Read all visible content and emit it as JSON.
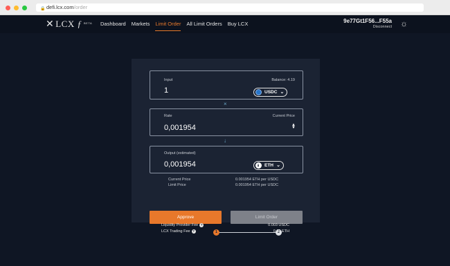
{
  "browser": {
    "url_host": "defi.lcx.com",
    "url_path": "/order"
  },
  "nav": {
    "logo_text": "LCX",
    "beta_label": "BETA",
    "links": [
      "Dashboard",
      "Markets",
      "Limit Order",
      "All Limit Orders",
      "Buy LCX"
    ],
    "active_link": "Limit Order",
    "wallet_address": "9e77Gt1F56...F55a",
    "disconnect_label": "Disconnect"
  },
  "order": {
    "input": {
      "label": "Input",
      "balance": "Balance: 4.19",
      "value": "1",
      "token": "USDC"
    },
    "rate": {
      "label": "Rate",
      "current_price_label": "Current Price",
      "value": "0,001954"
    },
    "output": {
      "label": "Output (estimated)",
      "value": "0,001954",
      "token": "ETH"
    },
    "price_info": {
      "current_price_label": "Current Price",
      "current_price_value": "0.001954 ETH per USDC",
      "limit_price_label": "Limit Price",
      "limit_price_value": "0.001954 ETH per USDC"
    },
    "approve_label": "Approve",
    "limit_order_label": "Limit Order",
    "steps": [
      "1",
      "2"
    ]
  },
  "fees": {
    "liquidity_label": "Liquidity Provider Fee",
    "liquidity_value": "0.003 USDC",
    "trading_label": "LCX Trading Fee",
    "trading_value": "0.02 ETH"
  },
  "colors": {
    "accent": "#e8782b",
    "background": "#0f1624",
    "panel": "#1b2333"
  }
}
